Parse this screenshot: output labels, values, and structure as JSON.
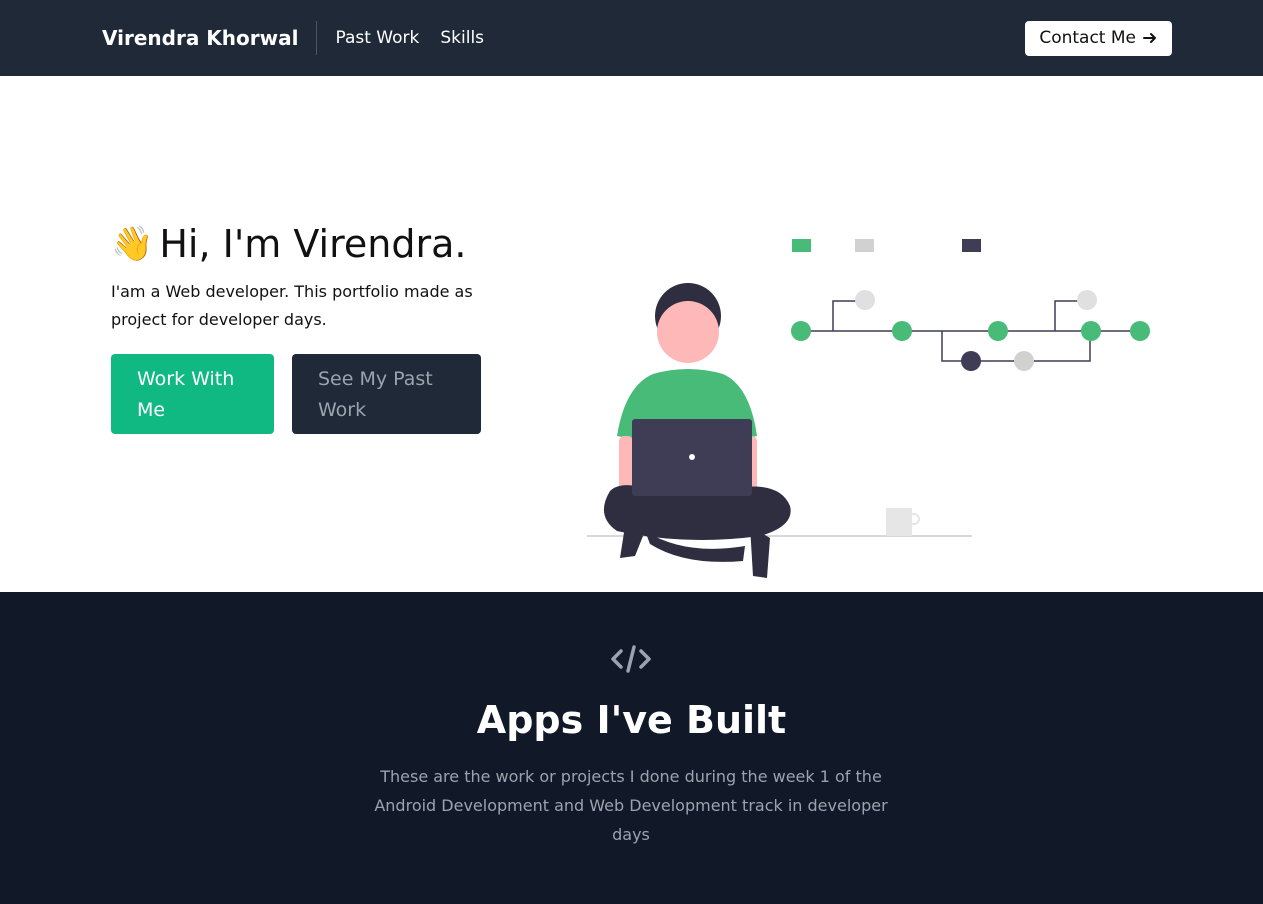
{
  "nav": {
    "brand": "Virendra Khorwal",
    "links": [
      "Past Work",
      "Skills"
    ],
    "contact_label": "Contact Me"
  },
  "hero": {
    "wave_icon": "waving-hand-icon",
    "title": "Hi, I'm Virendra.",
    "subtitle": "I'am a Web developer. This portfolio made as project for developer days.",
    "primary_button": "Work With Me",
    "secondary_button": "See My Past Work"
  },
  "apps": {
    "icon": "code-icon",
    "title": "Apps I've Built",
    "description": "These are the work or projects I done during the week 1 of the Android Development and Web Development track in developer days"
  },
  "colors": {
    "nav_bg": "#1f2937",
    "section_bg": "#111827",
    "accent_green": "#10b981",
    "illustration_green": "#48bb78",
    "illustration_dark": "#3f3d56",
    "muted_text": "#9ca3af"
  }
}
